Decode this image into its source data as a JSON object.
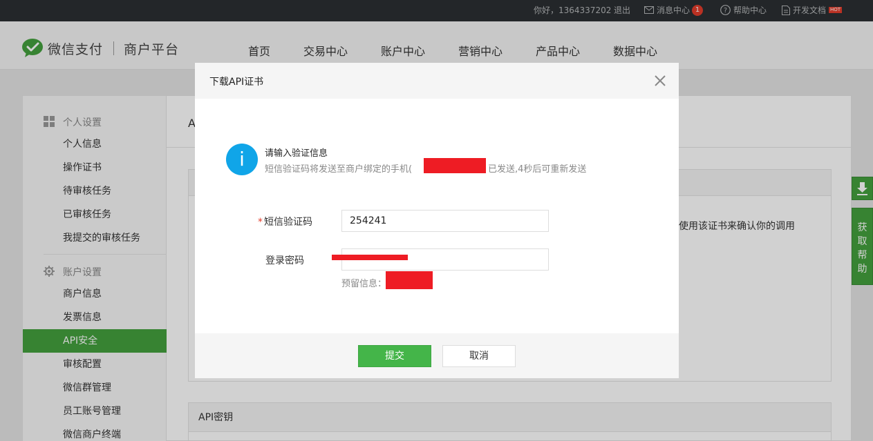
{
  "topbar": {
    "greeting": "你好，1364337202",
    "logout": "退出",
    "messages": "消息中心",
    "messages_count": "1",
    "help": "帮助中心",
    "dev_docs": "开发文档",
    "hot_badge": "HOT"
  },
  "header": {
    "brand": "微信支付",
    "platform": "商户平台",
    "nav": [
      "首页",
      "交易中心",
      "账户中心",
      "营销中心",
      "产品中心",
      "数据中心"
    ]
  },
  "sidebar": {
    "section_personal": "个人设置",
    "personal_items": [
      "个人信息",
      "操作证书",
      "待审核任务",
      "已审核任务",
      "我提交的审核任务"
    ],
    "section_account": "账户设置",
    "account_items": [
      "商户信息",
      "发票信息",
      "API安全",
      "审核配置",
      "微信群管理",
      "员工账号管理",
      "微信商户终端"
    ],
    "active_item": "API安全"
  },
  "main": {
    "title_partial": "A",
    "bg_text": "使用该证书来确认你的调用",
    "panel2_title": "API密钥"
  },
  "side_tools": {
    "help_label": "获\n取\n帮\n助"
  },
  "modal": {
    "title": "下载API证书",
    "info_title": "请输入验证信息",
    "info_sub_prefix": "短信验证码将发送至商户绑定的手机(",
    "info_sub_suffix": "已发送,4秒后可重新发送",
    "sms_label": "短信验证码",
    "sms_value": "254241",
    "password_label": "登录密码",
    "reserved_label": "预留信息：",
    "submit": "提交",
    "cancel": "取消"
  },
  "colors": {
    "topbar_bg": "#2b2f33",
    "brand_green": "#44a03e",
    "info_blue": "#10a5e8",
    "alert_red": "#e33c2b",
    "redaction": "#ee1c24"
  },
  "icons": [
    "wechat-pay-logo-icon",
    "mail-icon",
    "help-circle-icon",
    "document-icon",
    "grid-icon",
    "gear-icon",
    "download-icon",
    "close-icon",
    "info-icon"
  ]
}
